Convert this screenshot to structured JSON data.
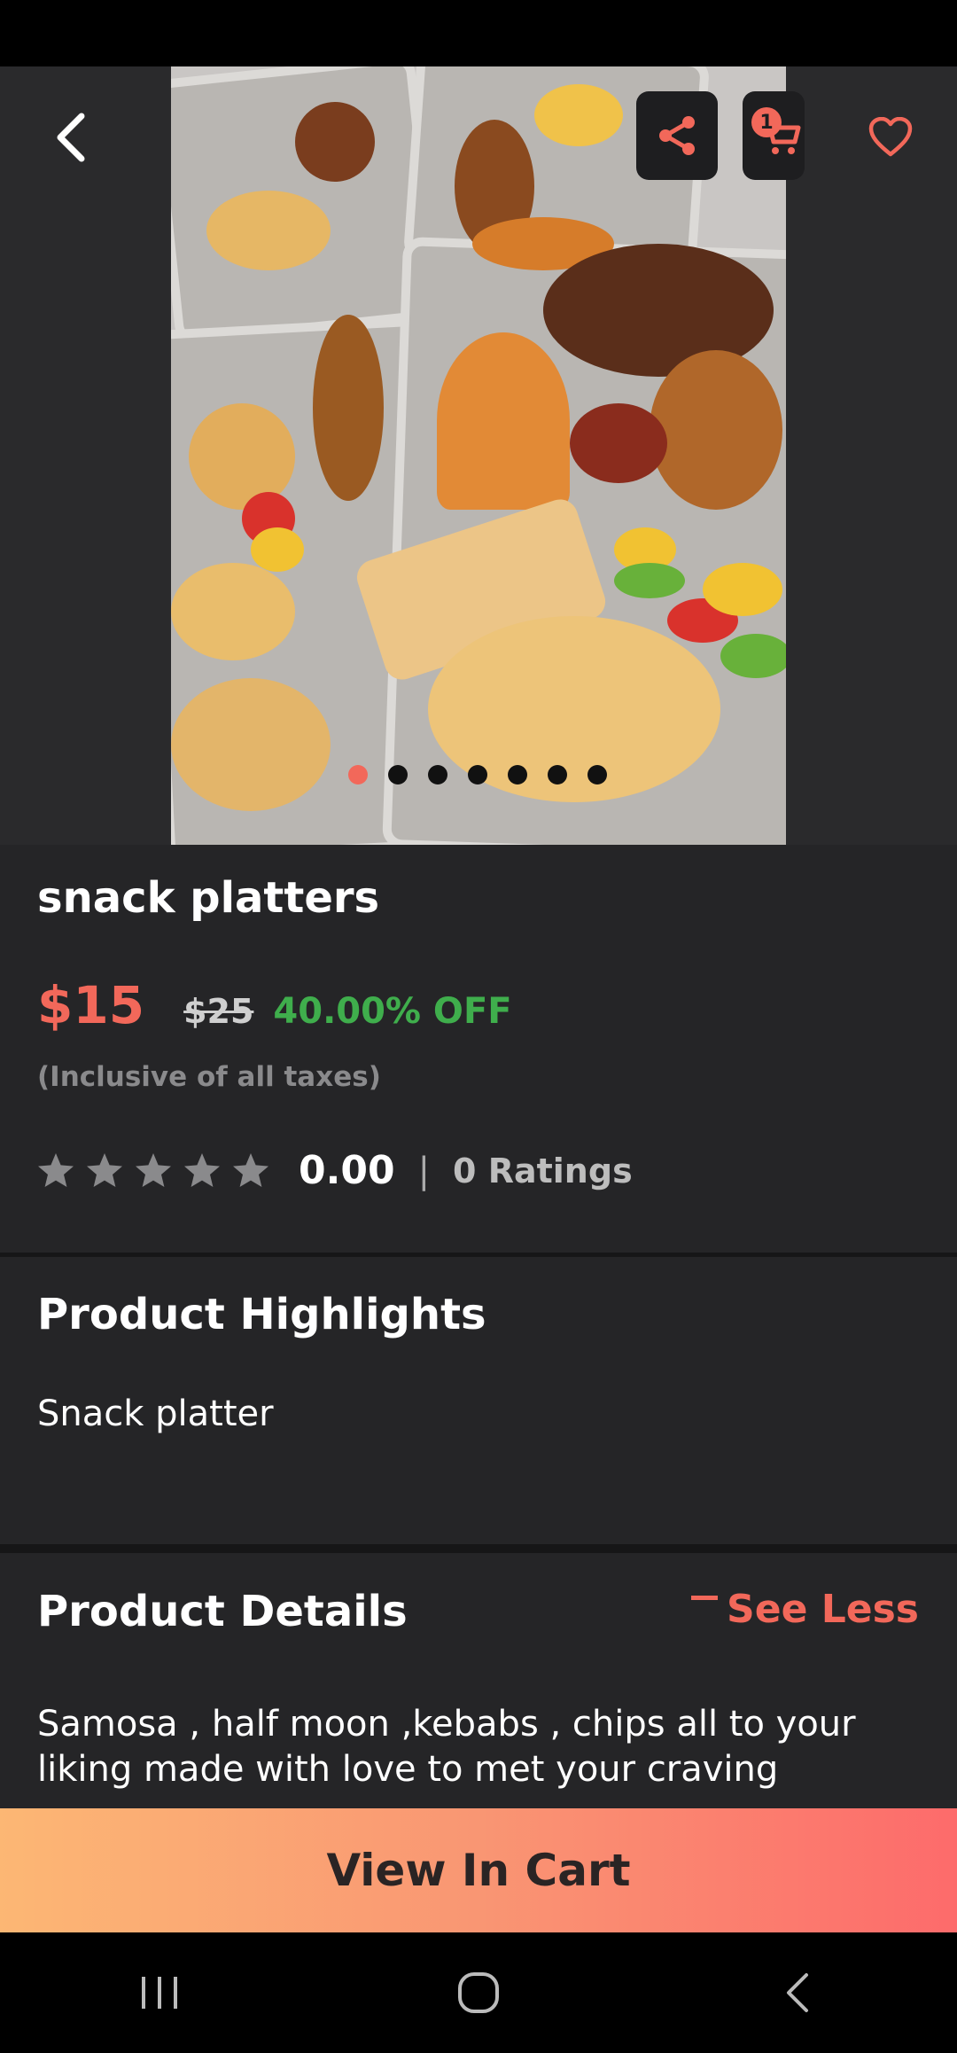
{
  "product": {
    "title": "snack platters",
    "price": "$15",
    "mrp": "$25",
    "discount": "40.00% OFF",
    "tax_note": "(Inclusive of all taxes)",
    "rating_value": "0.00",
    "rating_separator": "|",
    "rating_count": "0 Ratings",
    "stars_filled": 0,
    "stars_total": 5
  },
  "header": {
    "cart_badge": "1",
    "carousel_total": 7,
    "carousel_active": 1
  },
  "highlights": {
    "title": "Product Highlights",
    "text": "Snack platter"
  },
  "details": {
    "title": "Product Details",
    "toggle_label": "See Less",
    "text": "Samosa , half moon ,kebabs ,  chips all to your liking made with love to met your craving"
  },
  "cta": {
    "label": "View In Cart"
  },
  "colors": {
    "accent": "#f2685a",
    "discount": "#3fae4c",
    "background": "#252527"
  }
}
